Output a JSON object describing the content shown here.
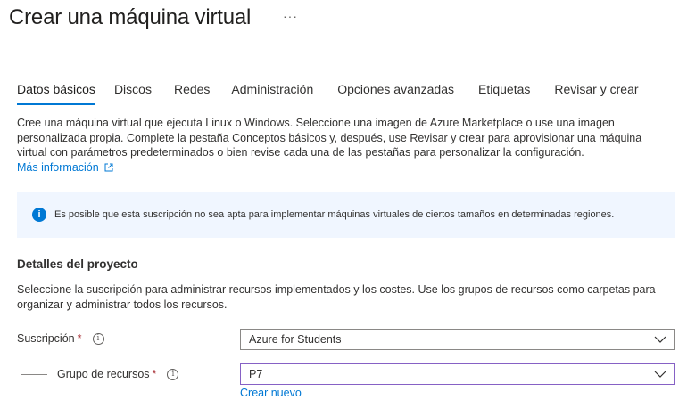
{
  "header": {
    "title": "Crear una máquina virtual",
    "more_label": "···"
  },
  "tabs": [
    {
      "label": "Datos básicos",
      "active": true
    },
    {
      "label": "Discos",
      "active": false
    },
    {
      "label": "Redes",
      "active": false
    },
    {
      "label": "Administración",
      "active": false
    },
    {
      "label": "Opciones avanzadas",
      "active": false
    },
    {
      "label": "Etiquetas",
      "active": false
    },
    {
      "label": "Revisar y crear",
      "active": false
    }
  ],
  "intro": {
    "text": "Cree una máquina virtual que ejecuta Linux o Windows. Seleccione una imagen de Azure Marketplace o use una imagen personalizada propia. Complete la pestaña Conceptos básicos y, después, use Revisar y crear para aprovisionar una máquina virtual con parámetros predeterminados o bien revise cada una de las pestañas para personalizar la configuración.",
    "more_info_link": "Más información"
  },
  "info_banner": {
    "icon": "info-icon",
    "text": "Es posible que esta suscripción no sea apta para implementar máquinas virtuales de ciertos tamaños en determinadas regiones."
  },
  "project_details": {
    "title": "Detalles del proyecto",
    "description": "Seleccione la suscripción para administrar recursos implementados y los costes. Use los grupos de recursos como carpetas para organizar y administrar todos los recursos.",
    "subscription": {
      "label": "Suscripción",
      "required_mark": "*",
      "value": "Azure for Students"
    },
    "resource_group": {
      "label": "Grupo de recursos",
      "required_mark": "*",
      "value": "P7",
      "create_new_link": "Crear nuevo"
    }
  },
  "colors": {
    "accent": "#0078d4",
    "info_bg": "#f0f6ff",
    "focus_border": "#8661c5",
    "required": "#a4262c"
  }
}
